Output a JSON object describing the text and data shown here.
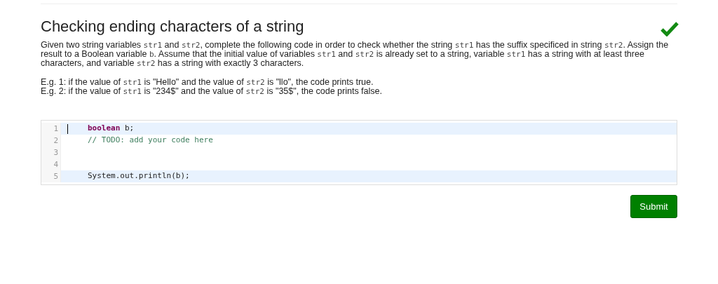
{
  "title": "Checking ending characters of a string",
  "solved": true,
  "description": [
    {
      "kind": "text",
      "text": "Given two string variables "
    },
    {
      "kind": "code",
      "text": "str1"
    },
    {
      "kind": "text",
      "text": " and "
    },
    {
      "kind": "code",
      "text": "str2"
    },
    {
      "kind": "text",
      "text": ", complete the following code in order to check whether the string "
    },
    {
      "kind": "code",
      "text": "str1"
    },
    {
      "kind": "text",
      "text": " has the suffix specificed in string "
    },
    {
      "kind": "code",
      "text": "str2"
    },
    {
      "kind": "text",
      "text": ". Assign the result to a Boolean variable "
    },
    {
      "kind": "code",
      "text": "b"
    },
    {
      "kind": "text",
      "text": ". Assume that the initial value of variables "
    },
    {
      "kind": "code",
      "text": "str1"
    },
    {
      "kind": "text",
      "text": " and "
    },
    {
      "kind": "code",
      "text": "str2"
    },
    {
      "kind": "text",
      "text": " is already set to a string, variable "
    },
    {
      "kind": "code",
      "text": "str1"
    },
    {
      "kind": "text",
      "text": " has a string with at least three characters, and variable "
    },
    {
      "kind": "code",
      "text": "str2"
    },
    {
      "kind": "text",
      "text": " has a string with exactly 3 characters."
    }
  ],
  "examples": [
    [
      {
        "kind": "text",
        "text": "E.g. 1: if the value of "
      },
      {
        "kind": "code",
        "text": "str1"
      },
      {
        "kind": "text",
        "text": " is \"Hello\" and the value of "
      },
      {
        "kind": "code",
        "text": "str2"
      },
      {
        "kind": "text",
        "text": " is \"llo\", the code prints true."
      }
    ],
    [
      {
        "kind": "text",
        "text": "E.g. 2: if the value of "
      },
      {
        "kind": "code",
        "text": "str1"
      },
      {
        "kind": "text",
        "text": " is \"234$\" and the value of "
      },
      {
        "kind": "code",
        "text": "str2"
      },
      {
        "kind": "text",
        "text": " is \"35$\", the code prints false."
      }
    ]
  ],
  "editor": {
    "lines": [
      {
        "number": "1",
        "highlighted": true,
        "cursor": true,
        "tokens": [
          {
            "kind": "keyword",
            "text": "boolean"
          },
          {
            "kind": "plain",
            "text": " b;"
          }
        ]
      },
      {
        "number": "2",
        "highlighted": false,
        "cursor": false,
        "tokens": [
          {
            "kind": "comment",
            "text": "// TODO: add your code here"
          }
        ]
      },
      {
        "number": "3",
        "highlighted": false,
        "cursor": false
      },
      {
        "number": "4",
        "highlighted": false,
        "cursor": false
      },
      {
        "number": "5",
        "highlighted": true,
        "cursor": false,
        "tokens": [
          {
            "kind": "plain",
            "text": "System.out.println(b);"
          }
        ]
      }
    ]
  },
  "submit_button": "Submit"
}
